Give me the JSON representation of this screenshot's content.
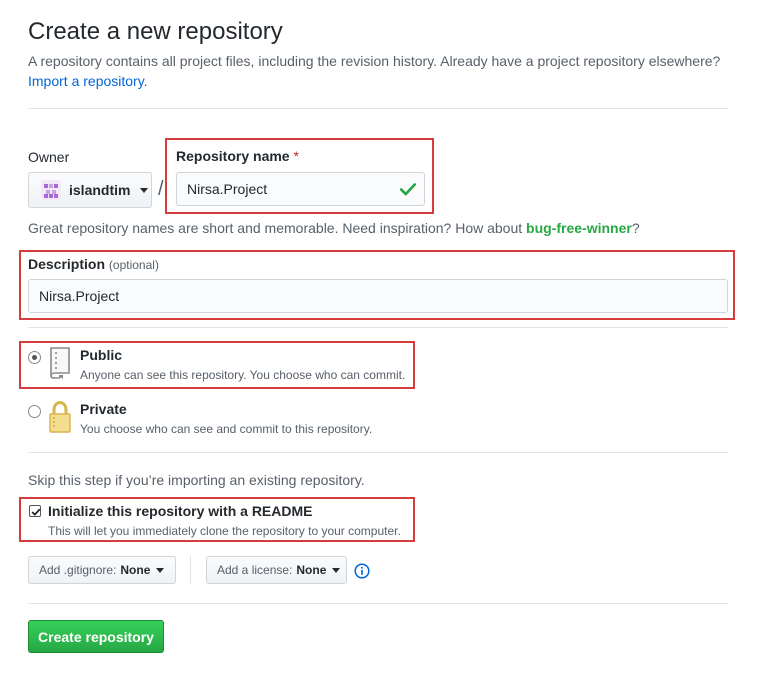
{
  "header": {
    "title": "Create a new repository",
    "subtitle": "A repository contains all project files, including the revision history. Already have a project repository elsewhere?",
    "import_link": "Import a repository."
  },
  "owner": {
    "label": "Owner",
    "name": "islandtim",
    "separator": "/"
  },
  "repo_name": {
    "label": "Repository name",
    "required_mark": "*",
    "value": "Nirsa.Project"
  },
  "hint": {
    "prefix": "Great repository names are short and memorable. Need inspiration? How about ",
    "suggestion": "bug-free-winner",
    "suffix": "?"
  },
  "description": {
    "label": "Description",
    "optional": "(optional)",
    "value": "Nirsa.Project"
  },
  "visibility": {
    "public": {
      "title": "Public",
      "desc": "Anyone can see this repository. You choose who can commit.",
      "selected": true
    },
    "private": {
      "title": "Private",
      "desc": "You choose who can see and commit to this repository.",
      "selected": false
    }
  },
  "import_note": "Skip this step if you’re importing an existing repository.",
  "readme": {
    "title": "Initialize this repository with a README",
    "desc": "This will let you immediately clone the repository to your computer.",
    "checked": true
  },
  "gitignore": {
    "label": "Add .gitignore:",
    "value": "None"
  },
  "license": {
    "label": "Add a license:",
    "value": "None"
  },
  "submit": {
    "label": "Create repository"
  },
  "colors": {
    "accent": "#28a745",
    "link": "#0366d6",
    "highlight_box": "#d63c3c"
  }
}
